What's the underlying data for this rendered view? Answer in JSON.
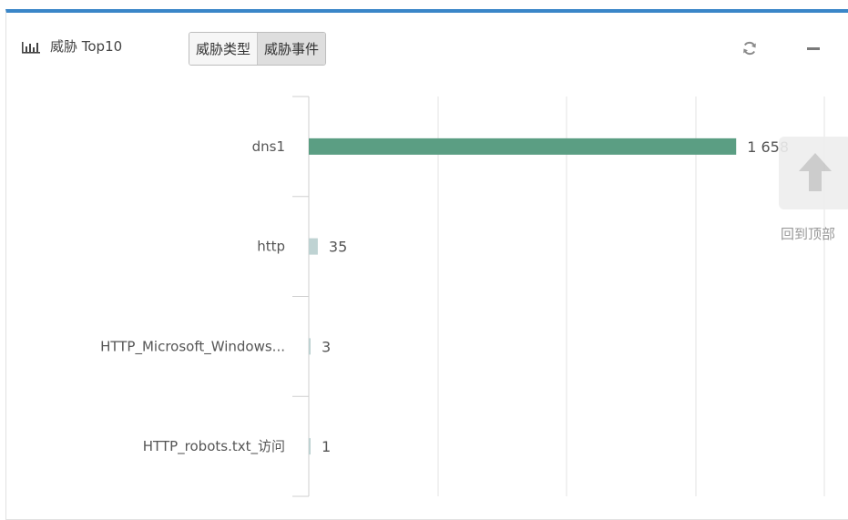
{
  "widget": {
    "title": "威胁 Top10",
    "tabs": [
      {
        "label": "威胁类型",
        "active": false
      },
      {
        "label": "威胁事件",
        "active": true
      }
    ],
    "refresh_icon": "refresh-icon",
    "minimize_icon": "minimize-icon",
    "chart_icon": "bar-chart-icon"
  },
  "colors": {
    "accent": "#3a86c8",
    "primary_bar": "#5b9e83",
    "secondary_bar": "#bfd3d3"
  },
  "chart_data": {
    "type": "bar",
    "orientation": "horizontal",
    "categories": [
      "dns1",
      "http",
      "HTTP_Microsoft_Windows...",
      "HTTP_robots.txt_访问"
    ],
    "values": [
      1658,
      35,
      3,
      1
    ],
    "value_labels": [
      "1 658",
      "35",
      "3",
      "1"
    ],
    "xlim": [
      0,
      2000
    ],
    "grid": true,
    "title": "",
    "xlabel": "",
    "ylabel": ""
  },
  "back_to_top": {
    "label": "回到顶部",
    "icon": "arrow-up-icon"
  }
}
